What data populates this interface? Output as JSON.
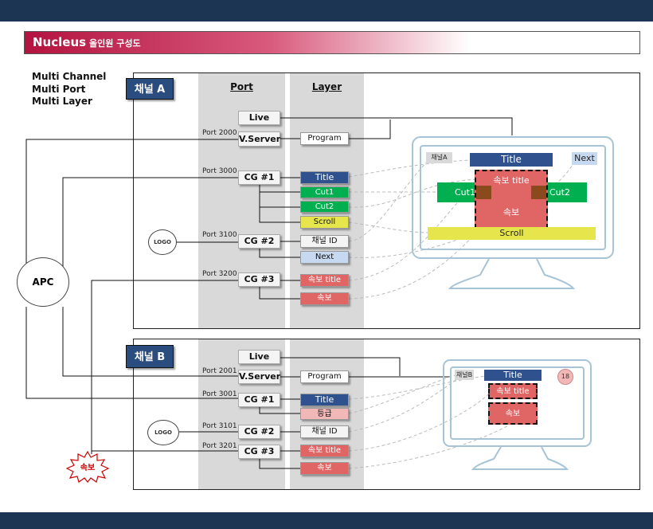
{
  "header": {
    "title": "Nucleus",
    "subtitle": "올인원 구성도"
  },
  "multi": [
    "Multi Channel",
    "Multi Port",
    "Multi Layer"
  ],
  "columns": {
    "port": "Port",
    "layer": "Layer"
  },
  "apc": "APC",
  "breaking_badge": "속보",
  "channel_a": {
    "tag": "채널 A",
    "live": "Live",
    "vserver": "V.Server",
    "cg1": "CG #1",
    "cg2": "CG #2",
    "cg3": "CG #3",
    "ports": [
      "Port 2000",
      "Port 3000",
      "Port 3100",
      "Port 3200"
    ],
    "logo": "LOGO",
    "layers": {
      "program": "Program",
      "title": "Title",
      "cut1": "Cut1",
      "cut2": "Cut2",
      "scroll": "Scroll",
      "chid": "채널 ID",
      "next": "Next",
      "sokbo_title": "속보 title",
      "sokbo": "속보"
    },
    "screen": {
      "chid": "채널A",
      "title": "Title",
      "next": "Next",
      "sokbo_title": "속보 title",
      "cut1": "Cut1",
      "cut2": "Cut2",
      "sokbo": "속보",
      "scroll": "Scroll"
    }
  },
  "channel_b": {
    "tag": "채널 B",
    "live": "Live",
    "vserver": "V.Server",
    "cg1": "CG #1",
    "cg2": "CG #2",
    "cg3": "CG #3",
    "ports": [
      "Port 2001",
      "Port 3001",
      "Port 3101",
      "Port 3201"
    ],
    "logo": "LOGO",
    "layers": {
      "program": "Program",
      "title": "Title",
      "grade": "등급",
      "chid": "채널 ID",
      "sokbo_title": "속보 title",
      "sokbo": "속보"
    },
    "screen": {
      "chid": "채널B",
      "title": "Title",
      "badge": "18",
      "sokbo_title": "속보 title",
      "sokbo": "속보"
    }
  },
  "colors": {
    "navy": "#1b3552",
    "title_blue": "#2f528f",
    "green": "#00b050",
    "red": "#e06666",
    "yellow": "#e6e64c",
    "light_blue": "#c6d9f1",
    "pink": "#f2b8b8",
    "magenta": "#b3133f"
  }
}
